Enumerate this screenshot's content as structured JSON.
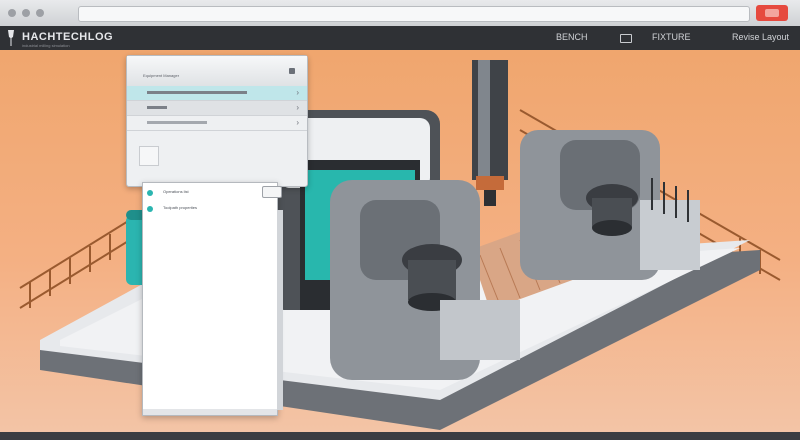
{
  "app": {
    "title": "HACHTECHLOG",
    "tagline": "industrial milling simulation",
    "header_center_label": "BENCH",
    "header_right_label": "FIXTURE",
    "header_far_right_label": "Revise Layout"
  },
  "panel": {
    "title": "Equipment Manager",
    "rows": [
      {
        "label": "row-1",
        "chevron": "›"
      },
      {
        "label": "row-2",
        "chevron": "›"
      },
      {
        "label": "row-3",
        "chevron": "›"
      }
    ]
  },
  "sidepanel": {
    "items": [
      {
        "label": "Operations list"
      },
      {
        "label": "Toolpath properties"
      }
    ]
  },
  "colors": {
    "accent": "#2bb5b0",
    "scene_top": "#f0a66e",
    "machine_body": "#8f949a",
    "close": "#e64a3f"
  },
  "icons": {
    "logo": "brush-icon",
    "view": "window-icon",
    "close": "close-icon"
  }
}
